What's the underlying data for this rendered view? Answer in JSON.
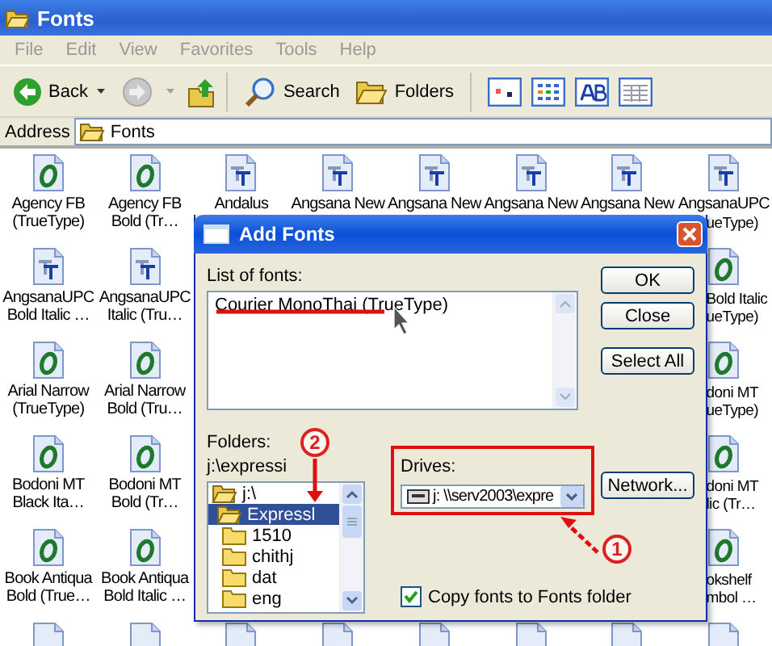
{
  "window": {
    "title": "Fonts"
  },
  "menu": [
    "File",
    "Edit",
    "View",
    "Favorites",
    "Tools",
    "Help"
  ],
  "toolbar": {
    "back": "Back",
    "search": "Search",
    "folders": "Folders"
  },
  "address": {
    "label": "Address",
    "value": "Fonts"
  },
  "icons": [
    [
      {
        "kind": "opentype",
        "label": [
          "Agency FB",
          "(TrueType)"
        ]
      },
      {
        "kind": "opentype",
        "label": [
          "Agency FB",
          "Bold (Tr…"
        ]
      },
      {
        "kind": "truetype",
        "label": [
          "Andalus"
        ]
      },
      {
        "kind": "truetype",
        "label": [
          "Angsana New"
        ]
      },
      {
        "kind": "truetype",
        "label": [
          "Angsana New"
        ]
      },
      {
        "kind": "truetype",
        "label": [
          "Angsana New"
        ]
      },
      {
        "kind": "truetype",
        "label": [
          "Angsana New"
        ]
      },
      {
        "kind": "truetype",
        "label": [
          "AngsanaUPC"
        ],
        "tail": [
          "ueType)"
        ]
      }
    ],
    [
      {
        "kind": "truetype",
        "label": [
          "AngsanaUPC",
          "Bold Italic …"
        ]
      },
      {
        "kind": "truetype",
        "label": [
          "AngsanaUPC",
          "Italic (Tru…"
        ]
      },
      {
        "kind": "covered"
      },
      {
        "kind": "covered"
      },
      {
        "kind": "covered"
      },
      {
        "kind": "covered"
      },
      {
        "kind": "covered"
      },
      {
        "kind": "opentype",
        "tail": [
          "Bold Italic",
          "ueType)"
        ]
      }
    ],
    [
      {
        "kind": "opentype",
        "label": [
          "Arial Narrow",
          "(TrueType)"
        ]
      },
      {
        "kind": "opentype",
        "label": [
          "Arial Narrow",
          "Bold (Tru…"
        ]
      },
      {
        "kind": "covered"
      },
      {
        "kind": "covered"
      },
      {
        "kind": "covered"
      },
      {
        "kind": "covered"
      },
      {
        "kind": "covered"
      },
      {
        "kind": "opentype",
        "tail": [
          "doni MT",
          "ueType)"
        ]
      }
    ],
    [
      {
        "kind": "opentype",
        "label": [
          "Bodoni MT",
          "Black Ita…"
        ]
      },
      {
        "kind": "opentype",
        "label": [
          "Bodoni MT",
          "Bold (Tr…"
        ]
      },
      {
        "kind": "covered"
      },
      {
        "kind": "covered"
      },
      {
        "kind": "covered"
      },
      {
        "kind": "covered"
      },
      {
        "kind": "covered"
      },
      {
        "kind": "opentype",
        "tail": [
          "doni MT",
          "lic (Tr…"
        ]
      }
    ],
    [
      {
        "kind": "opentype",
        "label": [
          "Book Antiqua",
          "Bold (True…"
        ]
      },
      {
        "kind": "opentype",
        "label": [
          "Book Antiqua",
          "Bold Italic …"
        ]
      },
      {
        "kind": "covered"
      },
      {
        "kind": "covered"
      },
      {
        "kind": "covered"
      },
      {
        "kind": "covered"
      },
      {
        "kind": "covered"
      },
      {
        "kind": "opentype",
        "tail": [
          "okshelf",
          "mbol …"
        ]
      }
    ],
    [
      {
        "kind": "page"
      },
      {
        "kind": "page"
      },
      {
        "kind": "page"
      },
      {
        "kind": "page"
      },
      {
        "kind": "page"
      },
      {
        "kind": "page"
      },
      {
        "kind": "page"
      },
      {
        "kind": "page"
      }
    ]
  ],
  "dialog": {
    "title": "Add Fonts",
    "list_label": "List of fonts:",
    "fonts": [
      "Courier MonoThai (TrueType)"
    ],
    "buttons": [
      "OK",
      "Close",
      "Select All"
    ],
    "folders_label": "Folders:",
    "folder_path": "j:\\expressi",
    "folders": [
      {
        "name": "j:\\",
        "open": true,
        "selected": false,
        "children": [
          {
            "name": "Expressl",
            "open": true,
            "selected": true,
            "children": [
              {
                "name": "1510",
                "open": false,
                "selected": false
              },
              {
                "name": "chithj",
                "open": false,
                "selected": false
              },
              {
                "name": "dat",
                "open": false,
                "selected": false
              },
              {
                "name": "eng",
                "open": false,
                "selected": false
              }
            ]
          }
        ]
      }
    ],
    "drives_label": "Drives:",
    "drive": "j: \\\\serv2003\\expre",
    "network_button": "Network...",
    "copy": {
      "label": "Copy fonts to Fonts folder",
      "checked": true
    }
  },
  "annotations": [
    {
      "number": "1"
    },
    {
      "number": "2"
    }
  ]
}
